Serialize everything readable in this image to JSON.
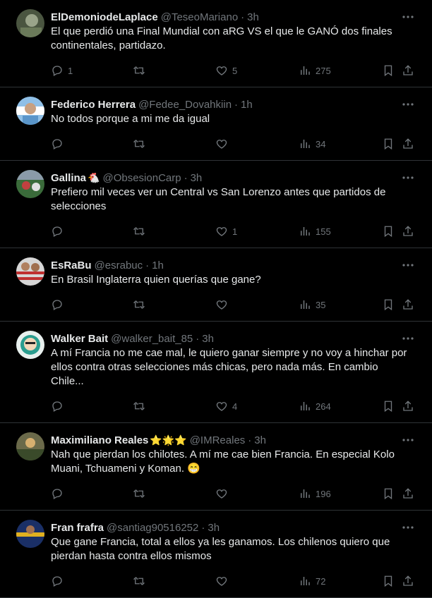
{
  "tweets": [
    {
      "name": "ElDemoniodeLaplace",
      "emoji": "",
      "handle": "@TeseoMariano",
      "time": "3h",
      "text": "El que perdió una Final Mundial con aRG VS el que le GANÓ dos finales\ncontinentales, partidazo.",
      "replies": "1",
      "retweets": "",
      "likes": "5",
      "views": "275",
      "avatar_color": "#5a6b4a"
    },
    {
      "name": "Federico Herrera",
      "emoji": "",
      "handle": "@Fedee_Dovahkiin",
      "time": "1h",
      "text": "No todos porque a mi me da igual",
      "replies": "",
      "retweets": "",
      "likes": "",
      "views": "34",
      "avatar_color": "#6ca6d9"
    },
    {
      "name": "Gallina",
      "emoji": "🐔",
      "handle": "@ObsesionCarp",
      "time": "3h",
      "text": "Prefiero mil veces ver un Central vs San Lorenzo antes que partidos de\nselecciones",
      "replies": "",
      "retweets": "",
      "likes": "1",
      "views": "155",
      "avatar_color": "#7a3a3a"
    },
    {
      "name": "EsRaBu",
      "emoji": "",
      "handle": "@esrabuc",
      "time": "1h",
      "text": "En Brasil Inglaterra quien querías que gane?",
      "replies": "",
      "retweets": "",
      "likes": "",
      "views": "35",
      "avatar_color": "#b04a4a"
    },
    {
      "name": "Walker Bait",
      "emoji": "",
      "handle": "@walker_bait_85",
      "time": "3h",
      "text": "A mí Francia no me cae mal, le quiero ganar siempre y no voy a hinchar por\nellos contra otras selecciones más chicas, pero nada más. En cambio\nChile...",
      "replies": "",
      "retweets": "",
      "likes": "4",
      "views": "264",
      "avatar_color": "#2a9d8f"
    },
    {
      "name": "Maximiliano Reales",
      "emoji": "⭐🌟⭐",
      "handle": "@IMReales",
      "time": "3h",
      "text": "Nah que pierdan los chilotes. A mí me cae bien Francia. En especial Kolo\nMuani, Tchuameni y Koman. 😁",
      "replies": "",
      "retweets": "",
      "likes": "",
      "views": "196",
      "avatar_color": "#8a7a3a"
    },
    {
      "name": "Fran frafra",
      "emoji": "",
      "handle": "@santiag90516252",
      "time": "3h",
      "text": "Que gane Francia, total a ellos ya les ganamos. Los chilenos quiero que\npierdan hasta contra ellos mismos",
      "replies": "",
      "retweets": "",
      "likes": "",
      "views": "72",
      "avatar_color": "#1f3a7a"
    }
  ],
  "colors": {
    "background": "#000000",
    "text": "#e7e9ea",
    "muted": "#71767b",
    "divider": "#2f3336"
  },
  "icons": [
    "reply-icon",
    "retweet-icon",
    "like-icon",
    "views-icon",
    "bookmark-icon",
    "share-icon",
    "more-icon"
  ]
}
